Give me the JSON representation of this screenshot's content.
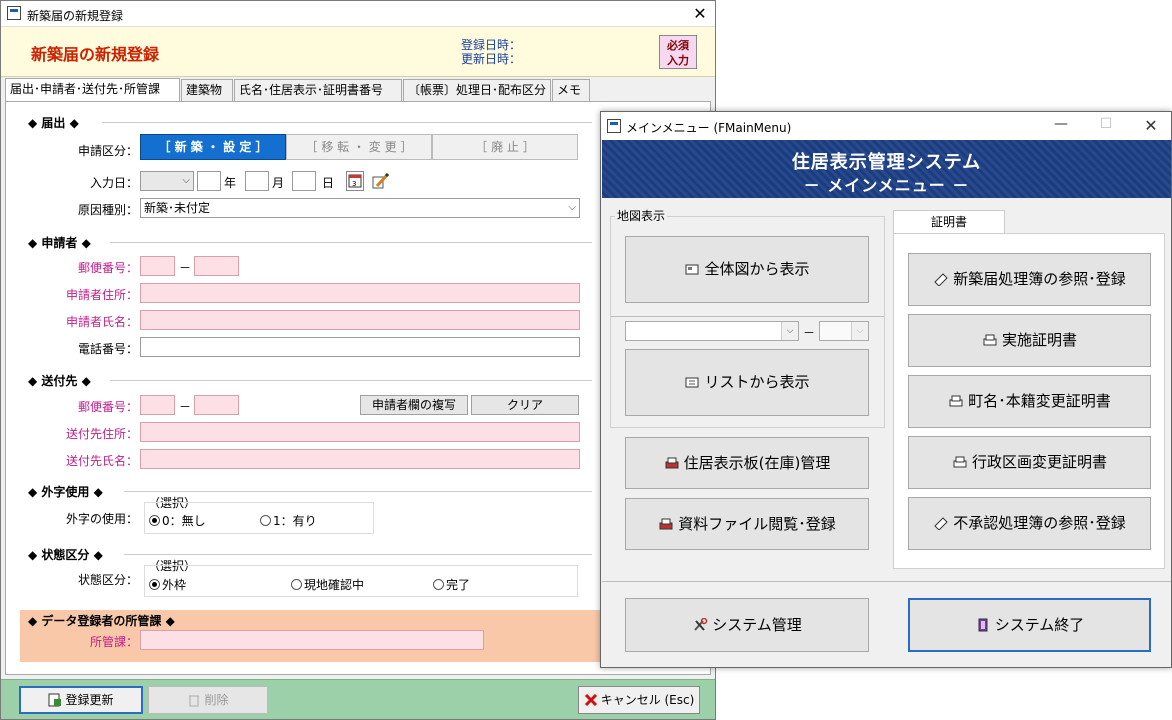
{
  "win1": {
    "title": "新築届の新規登録",
    "close": "✕",
    "header_title": "新築届の新規登録",
    "reg_date_label": "登録日時：",
    "upd_date_label": "更新日時：",
    "required_1": "必須",
    "required_2": "入力",
    "tabs": [
      "届出･申請者･送付先･所管課",
      "建築物",
      "氏名･住居表示･証明書番号",
      "〔帳票〕処理日･配布区分",
      "メモ"
    ],
    "sec_todoke": "◆ 届出 ◆",
    "shinsei_kubun_label": "申請区分：",
    "seg": [
      "［ 新 築 ・ 設 定 ］",
      "［ 移 転 ・ 変 更 ］",
      "［ 廃 止 ］"
    ],
    "nyuryoku_label": "入力日：",
    "nen": "年",
    "tsuki": "月",
    "hi": "日",
    "genin_label": "原因種別：",
    "genin_value": "新築･未付定",
    "sec_shinseisha": "◆ 申請者 ◆",
    "yubin_label": "郵便番号：",
    "dash": "－",
    "shinsei_addr_label": "申請者住所：",
    "shinsei_name_label": "申請者氏名：",
    "tel_label": "電話番号：",
    "sec_sofusaki": "◆ 送付先 ◆",
    "copy_btn": "申請者欄の複写",
    "clear_btn": "クリア",
    "sofu_addr_label": "送付先住所：",
    "sofu_name_label": "送付先氏名：",
    "sec_gaiji": "◆ 外字使用 ◆",
    "sentaku": "（選択）",
    "gaiji_label": "外字の使用：",
    "gaiji_opts": [
      "0：無し",
      "1：有り"
    ],
    "sec_jotai": "◆ 状態区分 ◆",
    "jotai_label": "状態区分：",
    "jotai_opts": [
      "外枠",
      "現地確認中",
      "完了"
    ],
    "sec_shokan": "◆ データ登録者の所管課 ◆",
    "shokan_label": "所管課：",
    "btn_save": "登録更新",
    "btn_delete": "削除",
    "btn_cancel": "キャンセル (Esc)"
  },
  "win2": {
    "title": "メインメニュー (FMainMenu)",
    "min": "—",
    "max": "☐",
    "close": "✕",
    "banner_1": "住居表示管理システム",
    "banner_2": "－ メインメニュー －",
    "map_group": "地図表示",
    "btn_zentai": "全体図から表示",
    "btn_list": "リストから表示",
    "combo_dash": "－",
    "btn_jukyo": "住居表示板(在庫)管理",
    "btn_shiryo": "資料ファイル閲覧･登録",
    "cert_tab": "証明書",
    "btn_shinchiku": "新築届処理簿の参照･登録",
    "btn_jisshi": "実施証明書",
    "btn_chomei": "町名･本籍変更証明書",
    "btn_gyosei": "行政区画変更証明書",
    "btn_fushonin": "不承認処理簿の参照･登録",
    "btn_system": "システム管理",
    "btn_exit": "システム終了"
  }
}
